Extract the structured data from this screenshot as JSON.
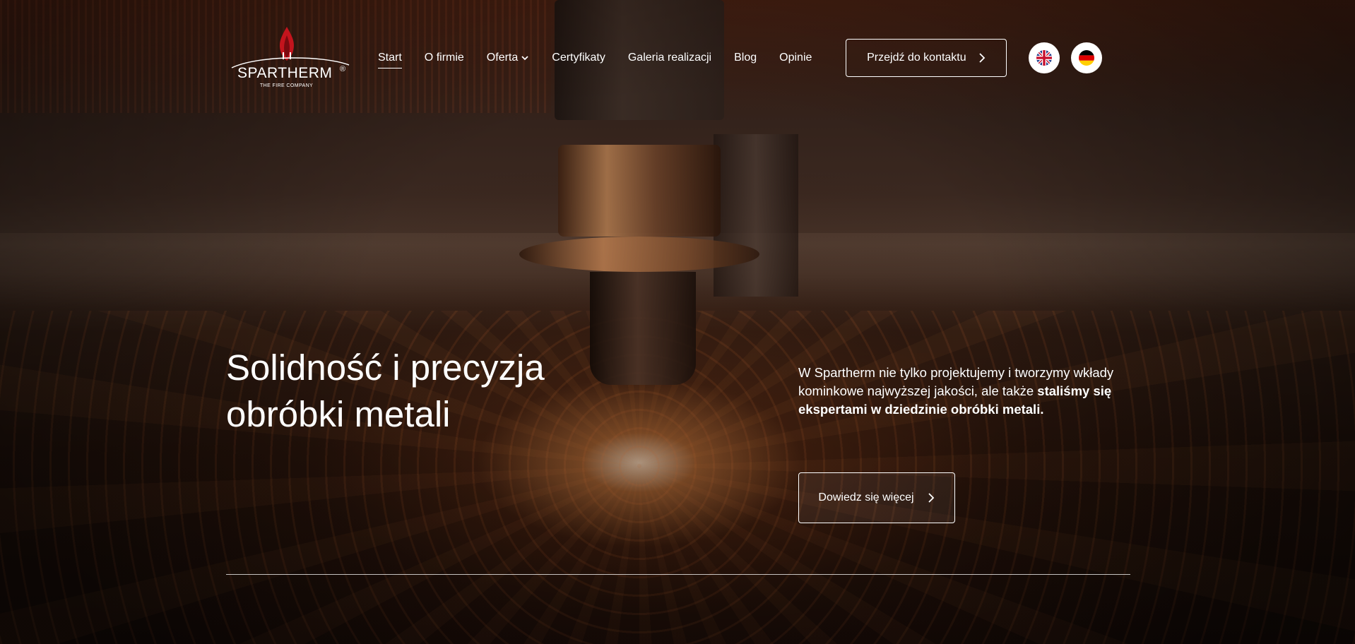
{
  "brand": {
    "name": "SPARTHERM",
    "registered_mark": "®",
    "tagline": "THE FIRE COMPANY",
    "flame_color": "#c4141d"
  },
  "nav": {
    "items": [
      {
        "label": "Start",
        "active": true
      },
      {
        "label": "O firmie",
        "active": false
      },
      {
        "label": "Oferta",
        "active": false,
        "has_dropdown": true
      },
      {
        "label": "Certyfikaty",
        "active": false
      },
      {
        "label": "Galeria realizacji",
        "active": false
      },
      {
        "label": "Blog",
        "active": false
      },
      {
        "label": "Opinie",
        "active": false
      }
    ],
    "contact_button": "Przejdź do kontaktu",
    "languages": [
      {
        "code": "en",
        "icon": "uk-flag-icon"
      },
      {
        "code": "de",
        "icon": "germany-flag-icon"
      }
    ]
  },
  "hero": {
    "headline_line1": "Solidność i precyzja",
    "headline_line2": "obróbki metali",
    "lead_text": "W Spartherm nie tylko projektujemy i tworzymy wkłady kominkowe najwyższej jakości, ale także",
    "lead_bold": "staliśmy się ekspertami w dziedzinie obróbki metali.",
    "cta_label": "Dowiedz się więcej"
  },
  "colors": {
    "text": "#ffffff",
    "background": "#1a0d08",
    "accent_glow": "#ffb060"
  }
}
